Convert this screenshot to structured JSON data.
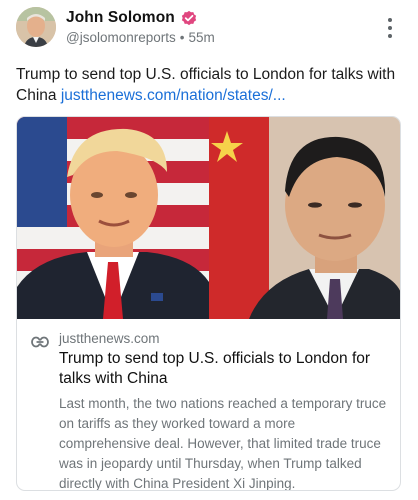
{
  "post": {
    "author": {
      "display_name": "John Solomon",
      "handle": "@jsolomonreports",
      "separator": "•",
      "time": "55m",
      "verified_icon": "verified-badge-icon",
      "verified_color": "#e0467f"
    },
    "more_icon": "vertical-ellipsis-icon",
    "text": "Trump to send top U.S. officials to London for talks with China",
    "link_text": "justthenews.com/nation/states/...",
    "link_color": "#1a6fd8"
  },
  "card": {
    "image_left": "portrait-photo-trump",
    "image_right": "portrait-photo-xi",
    "link_icon": "link-chain-icon",
    "domain": "justthenews.com",
    "title": "Trump to send top U.S. officials to London for talks with China",
    "description": "Last month, the two nations reached a temporary truce on tariffs as they worked toward a more comprehensive deal. However, that limited trade truce was in jeopardy until Thursday, when Trump talked directly with China President Xi Jinping."
  }
}
